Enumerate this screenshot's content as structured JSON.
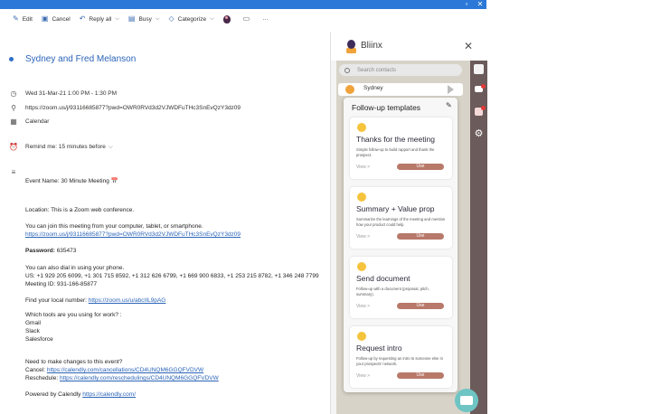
{
  "toolbar": {
    "edit": "Edit",
    "cancel": "Cancel",
    "reply_all": "Reply all",
    "busy": "Busy",
    "categorize": "Categorize",
    "more": "···"
  },
  "event": {
    "title": "Sydney and Fred Melanson",
    "datetime": "Wed 31-Mar-21 1:00 PM - 1:30 PM",
    "location": "https://zoom.us/j/93116685877?pwd=OWR0RVd3d2VJWDFuTHc3SnEvQzY3dz09",
    "calendar": "Calendar",
    "reminder": "Remind me:  15 minutes before"
  },
  "body": {
    "event_name": "Event Name: 30 Minute Meeting",
    "location_line": "Location: This is a Zoom web conference.",
    "join_line": "You can join this meeting from your computer, tablet, or smartphone.",
    "join_link": "https://zoom.us/j/93116685877?pwd=OWR0RVd3d2VJWDFuTHc3SnEvQzY3dz09",
    "password_label": "Password:",
    "password_value": "635473",
    "dial_line": "You can also dial in using your phone.",
    "us_line": "US: +1 929 205 6099, +1 301 715 8592, +1 312 626 6799, +1 669 900 6833, +1 253 215 8782, +1 346 248 7799",
    "meeting_id": "Meeting ID: 931-166-85877",
    "local_label": "Find your local number:",
    "local_link": "https://zoom.us/u/abcIIL9pAG",
    "tools_q": "Which tools are you using for work? :",
    "tool1": "Gmail",
    "tool2": "Slack",
    "tool3": "Salesforce",
    "changes": "Need to make changes to this event?",
    "cancel_label": "Cancel:",
    "cancel_link": "https://calendly.com/cancellations/CD4UNQM6GGQFVDVW",
    "reschedule_label": "Reschedule:",
    "reschedule_link": "https://calendly.com/reschedulings/CD4UNQM6GGQFVDVW",
    "powered_label": "Powered by Calendly",
    "powered_link": "https://calendly.com/"
  },
  "bliinx": {
    "brand": "Bliinx",
    "search_placeholder": "Search contacts",
    "contact_name": "Sydney",
    "templates_title": "Follow-up templates",
    "view_label": "View >",
    "use_label": "Use",
    "templates": [
      {
        "name": "Thanks for the meeting",
        "desc": "Simple follow-up to build rapport and thank the prospect."
      },
      {
        "name": "Summary + Value prop",
        "desc": "Summarize the learnings of the meeting and mention how your product could help."
      },
      {
        "name": "Send document",
        "desc": "Follow-up with a document (proposal, pitch, summary)."
      },
      {
        "name": "Request intro",
        "desc": "Follow-up by requesting an intro to someone else in your prospects' network."
      }
    ]
  },
  "colors": {
    "titlebar": "#2b78d8",
    "link": "#2b64b8",
    "use_button": "#b8796a",
    "sidebar": "#6b5b5b"
  }
}
